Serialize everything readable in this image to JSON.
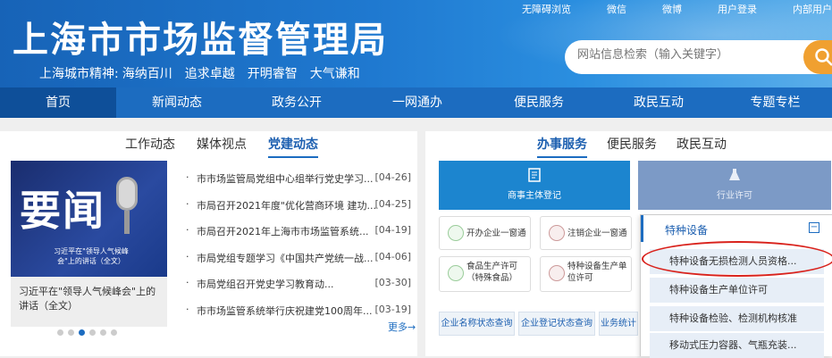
{
  "header": {
    "site_title": "上海市市场监督管理局",
    "slogan_prefix": "上海城市精神:",
    "slogan_parts": [
      "海纳百川",
      "追求卓越",
      "开明睿智",
      "大气谦和"
    ],
    "top_links": [
      "无障碍浏览",
      "微信",
      "微博",
      "用户登录",
      "内部用户"
    ],
    "search_placeholder": "网站信息检索（输入关键字）",
    "accent_color": "#f0a030"
  },
  "nav": {
    "items": [
      "首页",
      "新闻动态",
      "政务公开",
      "一网通办",
      "便民服务",
      "政民互动",
      "专题专栏"
    ],
    "active_index": 0
  },
  "left": {
    "tabs": [
      "工作动态",
      "媒体视点",
      "党建动态"
    ],
    "active_tab": 2,
    "feature": {
      "image_big_text": "要闻",
      "image_small_text": "习近平在\"领导人气候峰会\"上的讲话（全文）",
      "caption": "习近平在\"领导人气候峰会\"上的讲话（全文）"
    },
    "carousel_dot_count": 6,
    "carousel_active": 2,
    "news": [
      {
        "bullet": "·",
        "title": "市市场监管局党组中心组举行党史学习...",
        "date": "[04-26]"
      },
      {
        "bullet": "·",
        "title": "市局召开2021年度\"优化营商环境 建功...",
        "date": "[04-25]"
      },
      {
        "bullet": "·",
        "title": "市局召开2021年上海市市场监管系统...",
        "date": "[04-19]"
      },
      {
        "bullet": "·",
        "title": "市局党组专题学习《中国共产党统一战...",
        "date": "[04-06]"
      },
      {
        "bullet": "·",
        "title": "市局党组召开党史学习教育动...",
        "date": "[03-30]"
      },
      {
        "bullet": "·",
        "title": "市市场监管系统举行庆祝建党100周年...",
        "date": "[03-19]"
      }
    ],
    "more": "更多→"
  },
  "right": {
    "tabs": [
      "办事服务",
      "便民服务",
      "政民互动"
    ],
    "active_tab": 0,
    "tile_blue_label": "商事主体登记",
    "tile_gray_label": "行业许可",
    "service_cards": [
      {
        "line1": "开办企业一窗通",
        "line2": ""
      },
      {
        "line1": "注销企业一窗通",
        "line2": ""
      },
      {
        "line1": "食品生产许可",
        "line2": "（特殊食品）"
      },
      {
        "line1": "特种设备生产单",
        "line2": "位许可"
      }
    ],
    "query_buttons": [
      "企业名称状态查询",
      "企业登记状态查询",
      "业务统计"
    ],
    "dropdown": {
      "header": "特种设备",
      "collapse_symbol": "−",
      "items": [
        "特种设备无损检测人员资格...",
        "特种设备生产单位许可",
        "特种设备检验、检测机构核准",
        "移动式压力容器、气瓶充装..."
      ],
      "highlighted_index": 0,
      "highlight_color": "#d9221c"
    }
  }
}
